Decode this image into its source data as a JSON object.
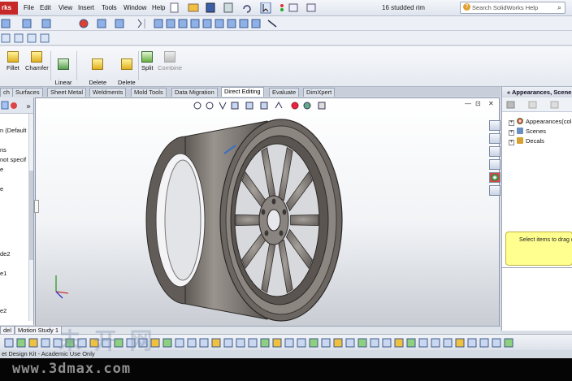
{
  "app": {
    "logo_text": "rks",
    "document_title": "16 studded rim"
  },
  "menu": [
    "File",
    "Edit",
    "View",
    "Insert",
    "Tools",
    "Window",
    "Help"
  ],
  "search": {
    "placeholder": "Search SolidWorks Help"
  },
  "commands": [
    {
      "label": "Fillet",
      "enabled": true
    },
    {
      "label": "Chamfer",
      "enabled": true
    },
    {
      "label": "Linear\nPattern",
      "enabled": true
    },
    {
      "label": "Delete\nSolid/Surface",
      "enabled": true
    },
    {
      "label": "Delete\nFace",
      "enabled": true
    },
    {
      "label": "Split",
      "enabled": true
    },
    {
      "label": "Combine",
      "enabled": false
    }
  ],
  "tabs": [
    {
      "label": "ch",
      "active": false
    },
    {
      "label": "Surfaces",
      "active": false
    },
    {
      "label": "Sheet Metal",
      "active": false
    },
    {
      "label": "Weldments",
      "active": false
    },
    {
      "label": "Mold Tools",
      "active": false
    },
    {
      "label": "Data Migration",
      "active": false
    },
    {
      "label": "Direct Editing",
      "active": true
    },
    {
      "label": "Evaluate",
      "active": false
    },
    {
      "label": "DimXpert",
      "active": false
    }
  ],
  "feature_tree": [
    "n (Default",
    "ns",
    "not specif",
    "e",
    "e",
    "de2",
    "e1",
    "e2"
  ],
  "task_pane": {
    "title": "Appearances, Scenes",
    "items": [
      "Appearances(col",
      "Scenes",
      "Decals"
    ],
    "hint": "Select items to drag o"
  },
  "bottom_tabs": [
    "del",
    "Motion Study 1"
  ],
  "status_text": "et Design Kit - Academic Use Only",
  "watermark": "www.3dmax.com",
  "watermark_cn": "未  开  网",
  "colors": {
    "accent": "#3a6fc4",
    "model": "#7a7470",
    "hint_bg": "#ffff90"
  }
}
